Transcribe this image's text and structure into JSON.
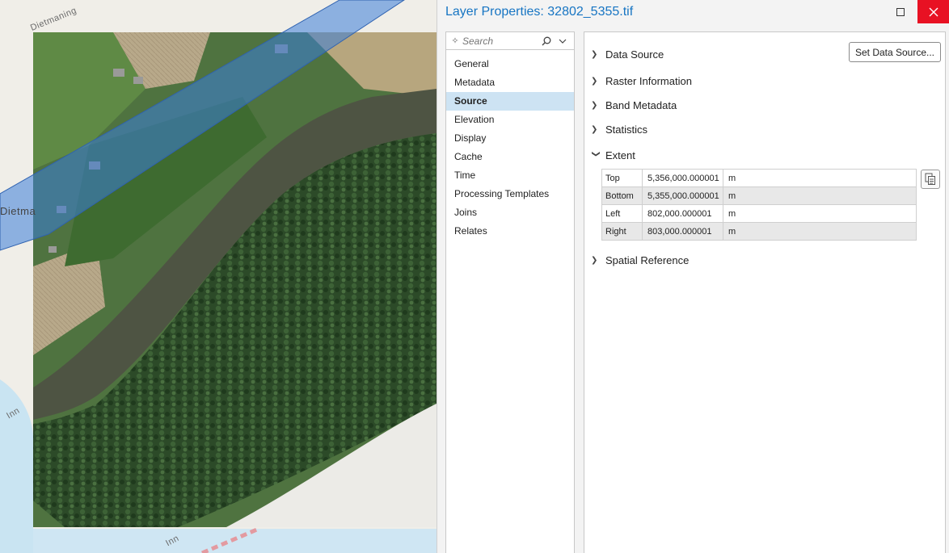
{
  "map": {
    "labels": {
      "dietmaning_top": "Dietmaning",
      "dietma_left": "Dietma",
      "inn_left": "Inn",
      "inn_bottom": "Inn"
    }
  },
  "dialog": {
    "title": "Layer Properties: 32802_5355.tif",
    "search_placeholder": "Search",
    "nav_items": [
      "General",
      "Metadata",
      "Source",
      "Elevation",
      "Display",
      "Cache",
      "Time",
      "Processing Templates",
      "Joins",
      "Relates"
    ],
    "active_nav": "Source",
    "set_source_label": "Set Data Source...",
    "sections": {
      "data_source": "Data Source",
      "raster_information": "Raster Information",
      "band_metadata": "Band Metadata",
      "statistics": "Statistics",
      "extent": "Extent",
      "spatial_reference": "Spatial Reference"
    },
    "extent_rows": [
      {
        "label": "Top",
        "value": "5,356,000.000001",
        "unit": "m"
      },
      {
        "label": "Bottom",
        "value": "5,355,000.000001",
        "unit": "m"
      },
      {
        "label": "Left",
        "value": "802,000.000001",
        "unit": "m"
      },
      {
        "label": "Right",
        "value": "803,000.000001",
        "unit": "m"
      }
    ]
  },
  "colors": {
    "title": "#1775c3",
    "close": "#e81123",
    "active_nav": "#cde3f3",
    "buffer_band": "#3b7ed8"
  },
  "icons": {
    "maximize": "maximize-icon",
    "close": "close-icon",
    "search": "search-icon",
    "dropdown": "chevron-down-icon",
    "copy": "copy-icon",
    "collapsed": "chevron-right-icon",
    "expanded": "chevron-down-icon"
  }
}
